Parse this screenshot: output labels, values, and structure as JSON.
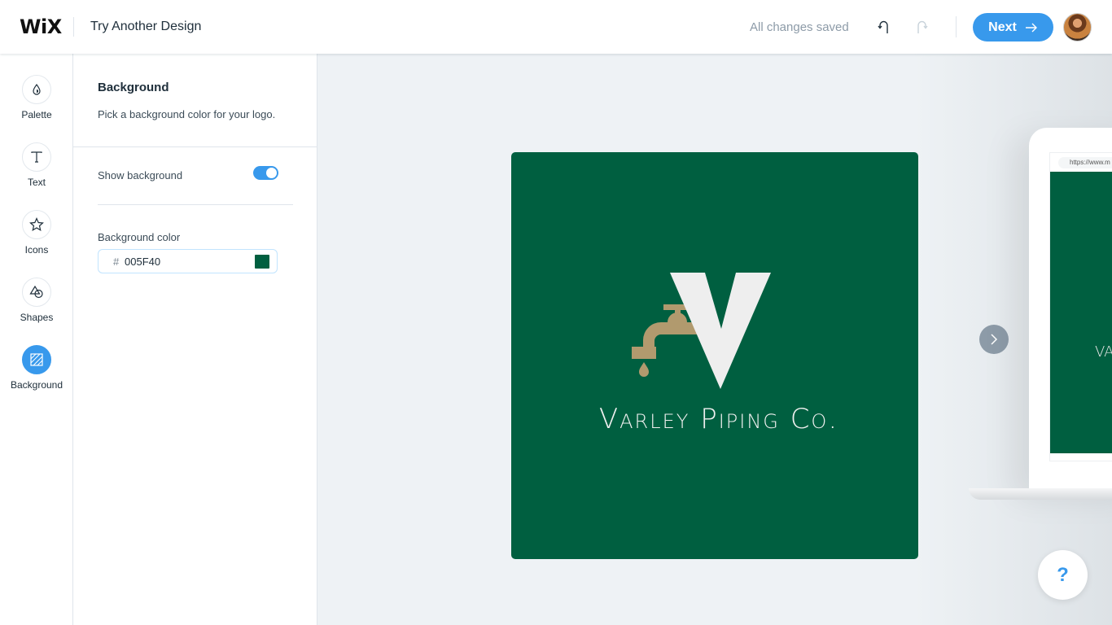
{
  "header": {
    "brand": "WiX",
    "title": "Try Another Design",
    "status": "All changes saved",
    "undo_icon": "undo-icon",
    "redo_icon": "redo-icon",
    "next_label": "Next",
    "next_icon": "arrow-right-icon",
    "avatar": "user-avatar"
  },
  "nav": {
    "items": [
      {
        "label": "Palette",
        "icon": "droplet-icon",
        "active": false
      },
      {
        "label": "Text",
        "icon": "text-t-icon",
        "active": false
      },
      {
        "label": "Icons",
        "icon": "star-icon",
        "active": false
      },
      {
        "label": "Shapes",
        "icon": "shapes-icon",
        "active": false
      },
      {
        "label": "Background",
        "icon": "background-hatch-icon",
        "active": true
      }
    ]
  },
  "panel": {
    "title": "Background",
    "description": "Pick a background color for your logo.",
    "show_background_label": "Show background",
    "show_background": true,
    "color_label": "Background color",
    "hash": "#",
    "color_value": "005F40"
  },
  "canvas": {
    "logo_name": "Varley Piping Co.",
    "logo_letter": "V",
    "logo_icon": "faucet-icon",
    "colors": {
      "background": "#005F40",
      "faucet": "#B19A6E",
      "text": "#F0F0F0",
      "accent": "#3899EC"
    },
    "preview_url": "https://www.m",
    "preview_text": "VA",
    "help_label": "?"
  }
}
